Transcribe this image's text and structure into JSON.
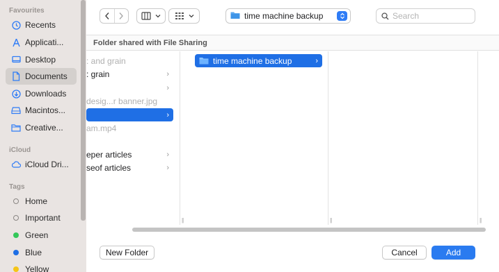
{
  "sidebar": {
    "favourites_heading": "Favourites",
    "favourites": [
      {
        "label": "Recents",
        "icon": "clock-icon"
      },
      {
        "label": "Applicati...",
        "icon": "applications-icon"
      },
      {
        "label": "Desktop",
        "icon": "desktop-icon"
      },
      {
        "label": "Documents",
        "icon": "document-icon",
        "selected": true
      },
      {
        "label": "Downloads",
        "icon": "download-icon"
      },
      {
        "label": "Macintos...",
        "icon": "hard-drive-icon"
      },
      {
        "label": "Creative...",
        "icon": "folder-icon"
      }
    ],
    "icloud_heading": "iCloud",
    "icloud": [
      {
        "label": "iCloud Dri...",
        "icon": "cloud-icon"
      }
    ],
    "tags_heading": "Tags",
    "tags": [
      {
        "label": "Home",
        "color": ""
      },
      {
        "label": "Important",
        "color": ""
      },
      {
        "label": "Green",
        "color": "#34c759"
      },
      {
        "label": "Blue",
        "color": "#1f6fe5"
      },
      {
        "label": "Yellow",
        "color": "#f5c518"
      }
    ]
  },
  "toolbar": {
    "path_label": "time machine backup",
    "search_placeholder": "Search"
  },
  "location_bar": "Folder shared with File Sharing",
  "columns": {
    "col1": [
      {
        "label": ": and grain",
        "dim": true,
        "chevron": false
      },
      {
        "label": ": grain",
        "dim": false,
        "chevron": true
      },
      {
        "label": "",
        "dim": false,
        "chevron": true
      },
      {
        "label": " desig...r banner.jpg",
        "dim": true,
        "chevron": false
      },
      {
        "label": "",
        "dim": false,
        "chevron": true,
        "selected": true
      },
      {
        "label": "am.mp4",
        "dim": true,
        "chevron": false
      },
      {
        "label": "",
        "dim": false,
        "chevron": false
      },
      {
        "label": "eper articles",
        "dim": false,
        "chevron": true
      },
      {
        "label": "seof articles",
        "dim": false,
        "chevron": true
      }
    ],
    "col2": [
      {
        "label": "time machine backup",
        "selected": true,
        "chevron": true
      }
    ]
  },
  "buttons": {
    "new_folder": "New Folder",
    "cancel": "Cancel",
    "add": "Add"
  },
  "colors": {
    "accent": "#2a7bf0",
    "selection": "#1f6fe5",
    "sidebar_bg": "#e9e4e2"
  }
}
